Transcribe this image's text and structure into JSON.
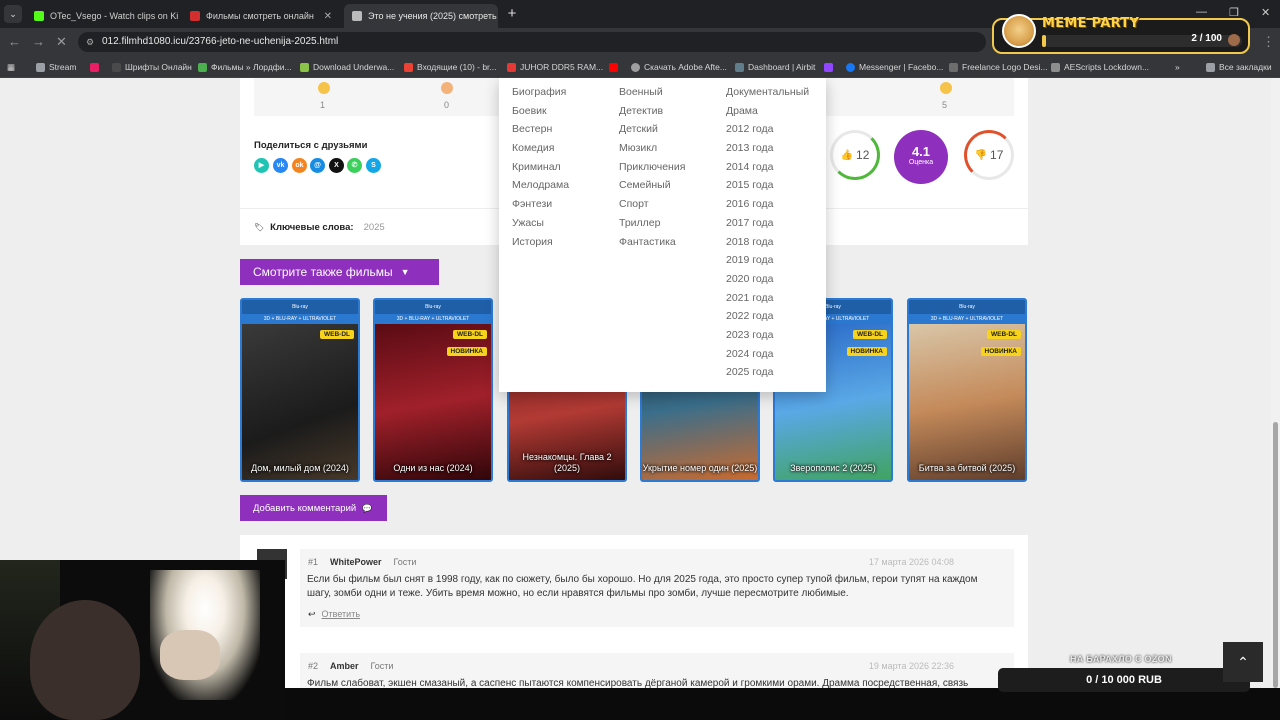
{
  "browser": {
    "tabs": [
      {
        "title": "OTec_Vsego - Watch clips on Ki",
        "fav_color": "#53fc18"
      },
      {
        "title": "Фильмы смотреть онлайн",
        "fav_color": "#d32f2f"
      },
      {
        "title": "Это не учения (2025) смотреть",
        "fav_color": "#bbbbbb"
      }
    ],
    "url": "012.filmhd1080.icu/23766-jeto-ne-uchenija-2025.html",
    "bookmarks": [
      {
        "label": "Stream",
        "fav_color": "#9aa0a6"
      },
      {
        "label": "",
        "fav_color": "#e91e63"
      },
      {
        "label": "Шрифты Онлайн",
        "fav_color": "#4a4a4a"
      },
      {
        "label": "Фильмы » Лордфи...",
        "fav_color": "#4caf50"
      },
      {
        "label": "Download Underwa...",
        "fav_color": "#8bc34a"
      },
      {
        "label": "Входящие (10) - br...",
        "fav_color": "#ea4335"
      },
      {
        "label": "JUHOR DDR5 RAM...",
        "fav_color": "#e53935"
      },
      {
        "label": "",
        "fav_color": "#ff0000"
      },
      {
        "label": "Скачать Adobe Afte...",
        "fav_color": "#9e9e9e"
      },
      {
        "label": "Dashboard | Airbit",
        "fav_color": "#607d8b"
      },
      {
        "label": "",
        "fav_color": "#9146ff"
      },
      {
        "label": "Messenger | Facebo...",
        "fav_color": "#1877f2"
      },
      {
        "label": "Freelance Logo Desi...",
        "fav_color": "#6d6d6d"
      },
      {
        "label": "AEScripts Lockdown...",
        "fav_color": "#8d8d8d"
      }
    ],
    "all_bookmarks": "Все закладки"
  },
  "meme_widget": {
    "title": "MEME PARTY",
    "count": "2 / 100",
    "progress": 0.02
  },
  "rating_strip": {
    "counts": [
      "1",
      "0",
      "5"
    ]
  },
  "share": {
    "title": "Поделиться с друзьями",
    "icons": [
      {
        "name": "vk-play-icon",
        "text": "▶",
        "color": "#1fc4b5"
      },
      {
        "name": "vk-icon",
        "text": "vk",
        "color": "#2787f5"
      },
      {
        "name": "odnoklassniki-icon",
        "text": "ok",
        "color": "#f48420"
      },
      {
        "name": "moimir-icon",
        "text": "@",
        "color": "#168de2"
      },
      {
        "name": "telegram-icon",
        "text": "➤",
        "color": "#2ca5e0"
      },
      {
        "name": "x-icon",
        "text": "X",
        "color": "#111111"
      },
      {
        "name": "whatsapp-icon",
        "text": "✆",
        "color": "#3bd05b"
      },
      {
        "name": "skype-icon",
        "text": "S",
        "color": "#13a7e8"
      }
    ]
  },
  "votes": {
    "likes": "12",
    "score": "4.1",
    "score_label": "Оценка",
    "dislikes": "17"
  },
  "keywords": {
    "label": "Ключевые слова:",
    "value": "2025"
  },
  "see_also": "Смотрите также фильмы",
  "posters": [
    {
      "title": "Дом, милый дом (2024)",
      "badges": [
        "WEB-DL"
      ],
      "art": "linear-gradient(160deg,#3a3a3a,#1b1b1b 60%,#4a3a2a)"
    },
    {
      "title": "Одни из нас (2024)",
      "badges": [
        "WEB-DL",
        "НОВИНКА"
      ],
      "art": "linear-gradient(170deg,#5a0b14,#a0202a 50%,#2a0508)"
    },
    {
      "title": "Незнакомцы. Глава 2 (2025)",
      "badges": [],
      "art": "linear-gradient(170deg,#6a1a1a,#b23a34 55%,#2a0a0a)"
    },
    {
      "title": "Укрытие номер один (2025)",
      "badges": [],
      "art": "linear-gradient(170deg,#1c2f4a,#3a6e8a 50%,#d06a2a)"
    },
    {
      "title": "Зверополис 2 (2025)",
      "badges": [
        "WEB-DL",
        "НОВИНКА"
      ],
      "art": "linear-gradient(170deg,#2a6ac8,#5aa8e6 50%,#3fa35a)"
    },
    {
      "title": "Битва за битвой (2025)",
      "badges": [
        "WEB-DL",
        "НОВИНКА"
      ],
      "art": "linear-gradient(170deg,#d9c6a8,#c48a5a 50%,#5a3a2a)"
    }
  ],
  "add_comment": "Добавить комментарий",
  "comments": [
    {
      "num": "#1",
      "author": "WhitePower",
      "role": "Гости",
      "date": "17 марта 2026 04:08",
      "text": "Если бы фильм был снят в 1998 году, как по сюжету, было бы хорошо. Но для 2025 года, это просто супер тупой фильм, герои тупят на каждом шагу, зомби одни и теже. Убить время можно, но если нравятся фильмы про зомби, лучше пересмотрите любимые.",
      "reply": "Ответить"
    },
    {
      "num": "#2",
      "author": "Amber",
      "role": "Гости",
      "date": "19 марта 2026 22:36",
      "text": "Фильм слабоват, экшен смазаный, а саспенс пытаются компенсировать дёрганой камерой и громкими орами. Драмма посредственная, связь",
      "reply": ""
    }
  ],
  "genres_menu": {
    "col1": [
      "Биография",
      "Боевик",
      "Вестерн",
      "Комедия",
      "Криминал",
      "Мелодрама",
      "Фэнтези",
      "Ужасы",
      "История"
    ],
    "col2": [
      "Военный",
      "Детектив",
      "Детский",
      "Мюзикл",
      "Приключения",
      "Семейный",
      "Спорт",
      "Триллер",
      "Фантастика"
    ],
    "col3": [
      "Документальный",
      "Драма",
      "2012 года",
      "2013 года",
      "2014 года",
      "2015 года",
      "2016 года",
      "2017 года",
      "2018 года",
      "2019 года",
      "2020 года",
      "2021 года",
      "2022 года",
      "2023 года",
      "2024 года",
      "2025 года"
    ]
  },
  "donation": {
    "title": "НА БАРАХЛО С OZON",
    "value": "0 / 10 000 RUB",
    "progress": 0
  },
  "colors": {
    "accent": "#8e2fbd",
    "like": "#4fb83b",
    "dislike": "#e0522d"
  }
}
